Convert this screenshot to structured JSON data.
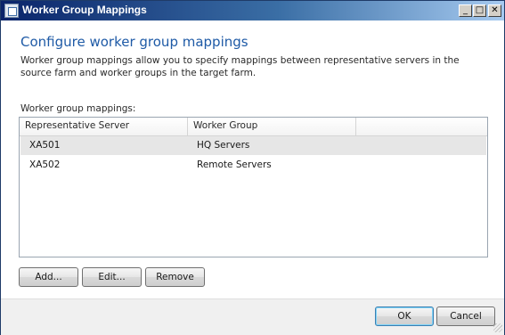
{
  "window": {
    "title": "Worker Group Mappings",
    "controls": {
      "minimize": "_",
      "maximize": "□",
      "close": "✕"
    }
  },
  "content": {
    "heading": "Configure worker group mappings",
    "description": "Worker group mappings allow you to specify mappings between representative servers in the source farm and worker groups in the target farm.",
    "list_label": "Worker group mappings:"
  },
  "table": {
    "columns": [
      "Representative Server",
      "Worker Group"
    ],
    "rows": [
      {
        "server": "XA501",
        "group": "HQ Servers",
        "selected": true
      },
      {
        "server": "XA502",
        "group": "Remote Servers",
        "selected": false
      }
    ]
  },
  "buttons": {
    "add": "Add...",
    "edit": "Edit...",
    "remove": "Remove",
    "ok": "OK",
    "cancel": "Cancel"
  },
  "colors": {
    "heading": "#1e5aa6",
    "selected_row": "#e6e6e6",
    "titlebar_start": "#0a246a"
  }
}
